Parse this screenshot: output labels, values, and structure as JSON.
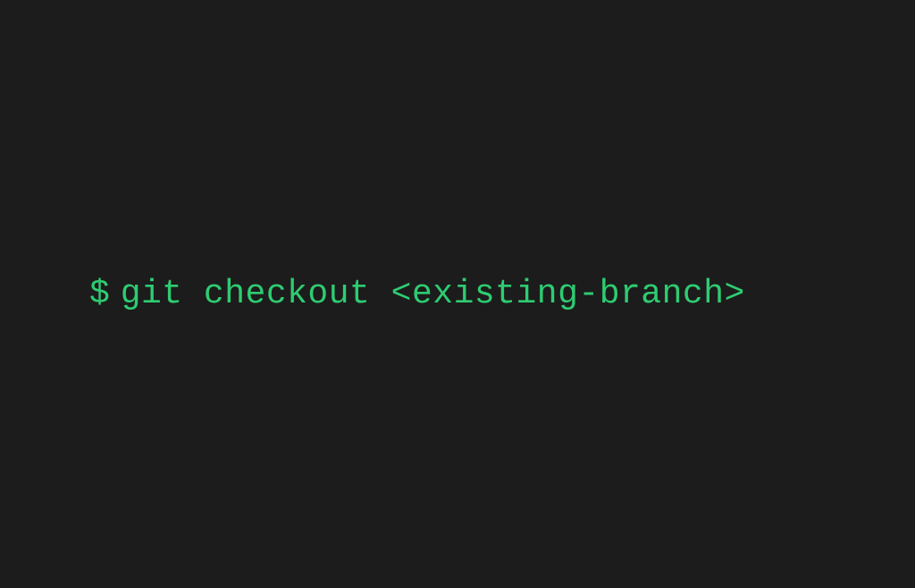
{
  "terminal": {
    "prompt": "$",
    "command": "git checkout <existing-branch>"
  }
}
